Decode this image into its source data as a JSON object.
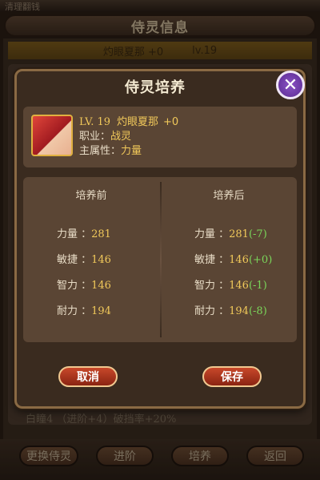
{
  "background": {
    "top_strip_text": "清理翻钱",
    "header_title": "侍灵信息",
    "name_bar": {
      "name": "灼眼夏那",
      "plus": "+0",
      "level": "lv.19"
    },
    "stat_line": "白瞳4 （进阶+4）破挡率+20%",
    "bottom_buttons": [
      "更换侍灵",
      "进阶",
      "培养",
      "返回"
    ]
  },
  "dialog": {
    "title": "侍灵培养",
    "close_icon": "close-icon",
    "hero": {
      "level": "LV. 19",
      "name": "灼眼夏那",
      "plus": "+0",
      "job_label": "职业：",
      "job": "战灵",
      "attr_label": "主属性：",
      "attr": "力量"
    },
    "before": {
      "heading": "培养前",
      "rows": [
        {
          "label": "力量 ：",
          "value": "281"
        },
        {
          "label": "敏捷 ：",
          "value": "146"
        },
        {
          "label": "智力 ：",
          "value": "146"
        },
        {
          "label": "耐力 ：",
          "value": "194"
        }
      ]
    },
    "after": {
      "heading": "培养后",
      "rows": [
        {
          "label": "力量 ：",
          "value": "281",
          "diff": "(-7)"
        },
        {
          "label": "敏捷 ：",
          "value": "146",
          "diff": "(+0)"
        },
        {
          "label": "智力 ：",
          "value": "146",
          "diff": "(-1)"
        },
        {
          "label": "耐力 ：",
          "value": "194",
          "diff": "(-8)"
        }
      ]
    },
    "cancel_label": "取消",
    "save_label": "保存"
  }
}
